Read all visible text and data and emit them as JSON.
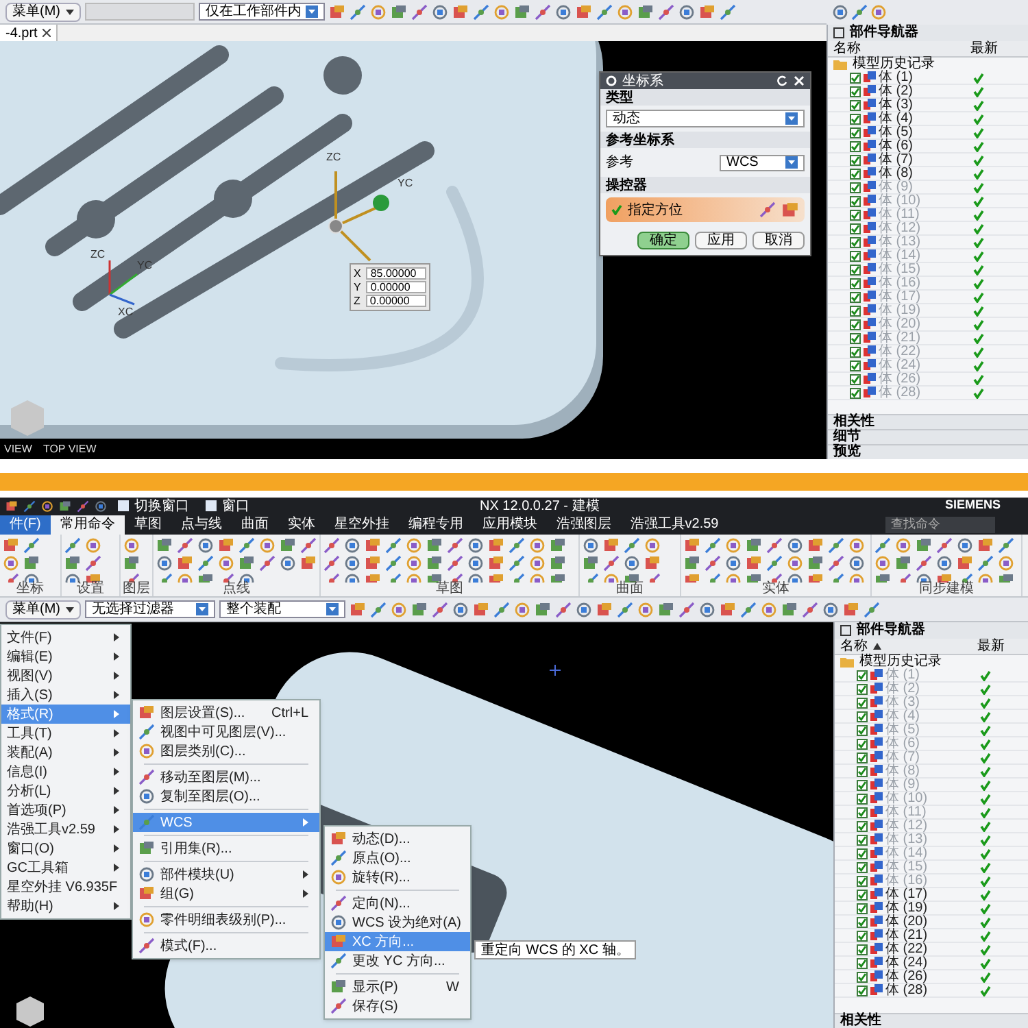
{
  "top_screen": {
    "toolbar": {
      "menu_button": "菜单(M)",
      "scope_dropdown": "仅在工作部件内"
    },
    "file_tab": "-4.prt",
    "viewport": {
      "handle_labels": [
        "ZC",
        "YC"
      ],
      "triad_labels": [
        "ZC",
        "YC",
        "XC"
      ],
      "view_labels": [
        "VIEW",
        "TOP VIEW"
      ]
    },
    "coord_input": [
      {
        "axis": "X",
        "value": "85.00000"
      },
      {
        "axis": "Y",
        "value": "0.00000"
      },
      {
        "axis": "Z",
        "value": "0.00000"
      }
    ],
    "dialog": {
      "title": "坐标系",
      "sections": [
        {
          "title": "类型",
          "kind": "dropdown",
          "value": "动态"
        },
        {
          "title": "参考坐标系",
          "kind": "labeled_dropdown",
          "label": "参考",
          "value": "WCS"
        },
        {
          "title": "操控器",
          "kind": "action",
          "label": "指定方位"
        }
      ],
      "buttons": [
        {
          "label": "确定",
          "default": true
        },
        {
          "label": "应用",
          "default": false
        },
        {
          "label": "取消",
          "default": false
        }
      ]
    },
    "navigator": {
      "title": "部件导航器",
      "columns": [
        "名称",
        "最新"
      ],
      "root": "模型历史记录",
      "items": [
        {
          "label": "体 (1)",
          "checked": true,
          "dimmed": false,
          "latest": true
        },
        {
          "label": "体 (2)",
          "checked": true,
          "dimmed": false,
          "latest": true
        },
        {
          "label": "体 (3)",
          "checked": true,
          "dimmed": false,
          "latest": true
        },
        {
          "label": "体 (4)",
          "checked": true,
          "dimmed": false,
          "latest": true
        },
        {
          "label": "体 (5)",
          "checked": true,
          "dimmed": false,
          "latest": true
        },
        {
          "label": "体 (6)",
          "checked": true,
          "dimmed": false,
          "latest": true
        },
        {
          "label": "体 (7)",
          "checked": true,
          "dimmed": false,
          "latest": true
        },
        {
          "label": "体 (8)",
          "checked": true,
          "dimmed": false,
          "latest": true
        },
        {
          "label": "体 (9)",
          "checked": true,
          "dimmed": true,
          "latest": true
        },
        {
          "label": "体 (10)",
          "checked": true,
          "dimmed": true,
          "latest": true
        },
        {
          "label": "体 (11)",
          "checked": true,
          "dimmed": true,
          "latest": true
        },
        {
          "label": "体 (12)",
          "checked": true,
          "dimmed": true,
          "latest": true
        },
        {
          "label": "体 (13)",
          "checked": true,
          "dimmed": true,
          "latest": true
        },
        {
          "label": "体 (14)",
          "checked": true,
          "dimmed": true,
          "latest": true
        },
        {
          "label": "体 (15)",
          "checked": true,
          "dimmed": true,
          "latest": true
        },
        {
          "label": "体 (16)",
          "checked": true,
          "dimmed": true,
          "latest": true
        },
        {
          "label": "体 (17)",
          "checked": true,
          "dimmed": true,
          "latest": true
        },
        {
          "label": "体 (19)",
          "checked": true,
          "dimmed": true,
          "latest": true
        },
        {
          "label": "体 (20)",
          "checked": true,
          "dimmed": true,
          "latest": true
        },
        {
          "label": "体 (21)",
          "checked": true,
          "dimmed": true,
          "latest": true
        },
        {
          "label": "体 (22)",
          "checked": true,
          "dimmed": true,
          "latest": true
        },
        {
          "label": "体 (24)",
          "checked": true,
          "dimmed": true,
          "latest": true
        },
        {
          "label": "体 (26)",
          "checked": true,
          "dimmed": true,
          "latest": true
        },
        {
          "label": "体 (28)",
          "checked": true,
          "dimmed": true,
          "latest": true
        }
      ],
      "panels": [
        "相关性",
        "细节",
        "预览"
      ]
    }
  },
  "bottom_screen": {
    "title_bar": {
      "quick_buttons": [
        "切换窗口",
        "窗口"
      ],
      "title": "NX 12.0.0.27 - 建模",
      "brand": "SIEMENS"
    },
    "tabs": [
      {
        "label": "件(F)",
        "kind": "file",
        "selected": false
      },
      {
        "label": "常用命令",
        "kind": "tab",
        "selected": true
      },
      {
        "label": "草图",
        "kind": "tab",
        "selected": false
      },
      {
        "label": "点与线",
        "kind": "tab",
        "selected": false
      },
      {
        "label": "曲面",
        "kind": "tab",
        "selected": false
      },
      {
        "label": "实体",
        "kind": "tab",
        "selected": false
      },
      {
        "label": "星空外挂",
        "kind": "tab",
        "selected": false
      },
      {
        "label": "编程专用",
        "kind": "tab",
        "selected": false
      },
      {
        "label": "应用模块",
        "kind": "tab",
        "selected": false
      },
      {
        "label": "浩强图层",
        "kind": "tab",
        "selected": false
      },
      {
        "label": "浩强工具v2.59",
        "kind": "tab",
        "selected": false
      }
    ],
    "search": {
      "placeholder": "查找命令"
    },
    "ribbon_groups": [
      "坐标",
      "设置",
      "图层",
      "点线",
      "草图",
      "曲面",
      "实体",
      "同步建模"
    ],
    "toolbar": {
      "menu_button": "菜单(M)",
      "filter_dropdown": "无选择过滤器",
      "scope_dropdown": "整个装配"
    },
    "main_menu": [
      {
        "label": "文件(F)",
        "selected": false
      },
      {
        "label": "编辑(E)",
        "selected": false
      },
      {
        "label": "视图(V)",
        "selected": false
      },
      {
        "label": "插入(S)",
        "selected": false
      },
      {
        "label": "格式(R)",
        "selected": true
      },
      {
        "label": "工具(T)",
        "selected": false
      },
      {
        "label": "装配(A)",
        "selected": false
      },
      {
        "label": "信息(I)",
        "selected": false
      },
      {
        "label": "分析(L)",
        "selected": false
      },
      {
        "label": "首选项(P)",
        "selected": false
      },
      {
        "label": "浩强工具v2.59",
        "selected": false
      },
      {
        "label": "窗口(O)",
        "selected": false
      },
      {
        "label": "GC工具箱",
        "selected": false
      },
      {
        "label": "星空外挂 V6.935F",
        "selected": false
      },
      {
        "label": "帮助(H)",
        "selected": false
      }
    ],
    "format_menu": [
      {
        "kind": "item",
        "label": "图层设置(S)...",
        "shortcut": "Ctrl+L",
        "selected": false
      },
      {
        "kind": "item",
        "label": "视图中可见图层(V)...",
        "selected": false
      },
      {
        "kind": "item",
        "label": "图层类别(C)...",
        "selected": false
      },
      {
        "kind": "separator"
      },
      {
        "kind": "item",
        "label": "移动至图层(M)...",
        "selected": false
      },
      {
        "kind": "item",
        "label": "复制至图层(O)...",
        "selected": false
      },
      {
        "kind": "separator"
      },
      {
        "kind": "submenu",
        "label": "WCS",
        "selected": true
      },
      {
        "kind": "separator"
      },
      {
        "kind": "item",
        "label": "引用集(R)...",
        "selected": false
      },
      {
        "kind": "separator"
      },
      {
        "kind": "submenu",
        "label": "部件模块(U)",
        "selected": false
      },
      {
        "kind": "submenu",
        "label": "组(G)",
        "selected": false
      },
      {
        "kind": "separator"
      },
      {
        "kind": "item",
        "label": "零件明细表级别(P)...",
        "selected": false
      },
      {
        "kind": "separator"
      },
      {
        "kind": "item",
        "label": "模式(F)...",
        "selected": false
      }
    ],
    "wcs_menu": [
      {
        "kind": "item",
        "label": "动态(D)...",
        "selected": false
      },
      {
        "kind": "item",
        "label": "原点(O)...",
        "selected": false
      },
      {
        "kind": "item",
        "label": "旋转(R)...",
        "selected": false
      },
      {
        "kind": "separator"
      },
      {
        "kind": "item",
        "label": "定向(N)...",
        "selected": false
      },
      {
        "kind": "item",
        "label": "WCS 设为绝对(A)",
        "selected": false
      },
      {
        "kind": "item",
        "label": "XC 方向...",
        "selected": true
      },
      {
        "kind": "item",
        "label": "更改 YC 方向...",
        "selected": false
      },
      {
        "kind": "separator"
      },
      {
        "kind": "item",
        "label": "显示(P)",
        "shortcut": "W",
        "selected": false
      },
      {
        "kind": "item",
        "label": "保存(S)",
        "selected": false
      }
    ],
    "tooltip": "重定向 WCS 的 XC 轴。",
    "navigator": {
      "title": "部件导航器",
      "columns": [
        "名称",
        "最新"
      ],
      "root": "模型历史记录",
      "items": [
        {
          "label": "体 (1)",
          "checked": true,
          "dimmed": true,
          "latest": true
        },
        {
          "label": "体 (2)",
          "checked": true,
          "dimmed": true,
          "latest": true
        },
        {
          "label": "体 (3)",
          "checked": true,
          "dimmed": true,
          "latest": true
        },
        {
          "label": "体 (4)",
          "checked": true,
          "dimmed": true,
          "latest": true
        },
        {
          "label": "体 (5)",
          "checked": true,
          "dimmed": true,
          "latest": true
        },
        {
          "label": "体 (6)",
          "checked": true,
          "dimmed": true,
          "latest": true
        },
        {
          "label": "体 (7)",
          "checked": true,
          "dimmed": true,
          "latest": true
        },
        {
          "label": "体 (8)",
          "checked": true,
          "dimmed": true,
          "latest": true
        },
        {
          "label": "体 (9)",
          "checked": true,
          "dimmed": true,
          "latest": true
        },
        {
          "label": "体 (10)",
          "checked": true,
          "dimmed": true,
          "latest": true
        },
        {
          "label": "体 (11)",
          "checked": true,
          "dimmed": true,
          "latest": true
        },
        {
          "label": "体 (12)",
          "checked": true,
          "dimmed": true,
          "latest": true
        },
        {
          "label": "体 (13)",
          "checked": true,
          "dimmed": true,
          "latest": true
        },
        {
          "label": "体 (14)",
          "checked": true,
          "dimmed": true,
          "latest": true
        },
        {
          "label": "体 (15)",
          "checked": true,
          "dimmed": true,
          "latest": true
        },
        {
          "label": "体 (16)",
          "checked": true,
          "dimmed": true,
          "latest": true
        },
        {
          "label": "体 (17)",
          "checked": true,
          "dimmed": false,
          "latest": true
        },
        {
          "label": "体 (19)",
          "checked": true,
          "dimmed": false,
          "latest": true
        },
        {
          "label": "体 (20)",
          "checked": true,
          "dimmed": false,
          "latest": true
        },
        {
          "label": "体 (21)",
          "checked": true,
          "dimmed": false,
          "latest": true
        },
        {
          "label": "体 (22)",
          "checked": true,
          "dimmed": false,
          "latest": true
        },
        {
          "label": "体 (24)",
          "checked": true,
          "dimmed": false,
          "latest": true
        },
        {
          "label": "体 (26)",
          "checked": true,
          "dimmed": false,
          "latest": true
        },
        {
          "label": "体 (28)",
          "checked": true,
          "dimmed": false,
          "latest": true
        }
      ],
      "panels": [
        "相关性"
      ]
    }
  }
}
